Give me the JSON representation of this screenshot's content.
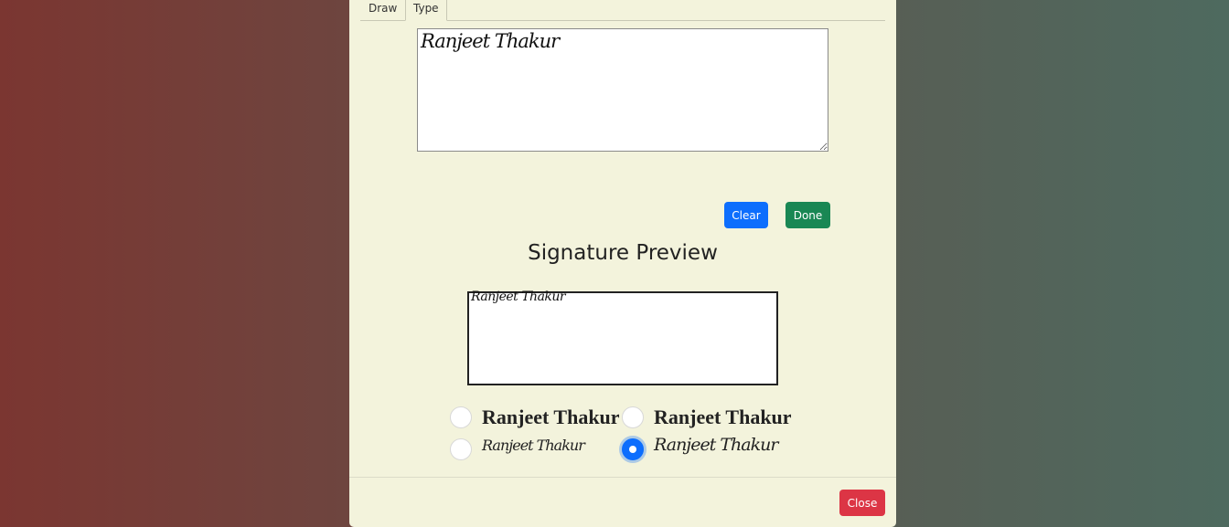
{
  "tabs": [
    {
      "label": "Draw"
    },
    {
      "label": "Type"
    }
  ],
  "signature_input": {
    "value": "Ranjeet Thakur"
  },
  "buttons": {
    "clear": "Clear",
    "done": "Done",
    "close": "Close"
  },
  "preview": {
    "title": "Signature Preview",
    "text": "Ranjeet Thakur"
  },
  "style_options": [
    {
      "label": "Ranjeet Thakur",
      "selected": false
    },
    {
      "label": "Ranjeet Thakur",
      "selected": false
    },
    {
      "label": "Ranjeet Thakur",
      "selected": false
    },
    {
      "label": "Ranjeet Thakur",
      "selected": true
    }
  ],
  "colors": {
    "modal_bg": "#f3f3dc",
    "primary": "#0d6efd",
    "success": "#198754",
    "danger": "#dc3545"
  }
}
